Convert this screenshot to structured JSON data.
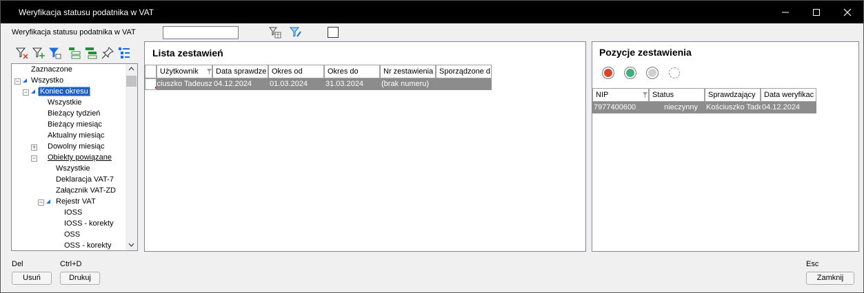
{
  "window": {
    "title": "Weryfikacja statusu podatnika w VAT"
  },
  "header": {
    "label": "Weryfikacja statusu podatnika w VAT",
    "search_value": ""
  },
  "tree": {
    "items": [
      {
        "label": "Zaznaczone"
      },
      {
        "label": "Wszystko"
      },
      {
        "label": "Koniec okresu"
      },
      {
        "label": "Wszystkie"
      },
      {
        "label": "Bieżący tydzień"
      },
      {
        "label": "Bieżący miesiąc"
      },
      {
        "label": "Aktualny miesiąc"
      },
      {
        "label": "Dowolny miesiąc"
      },
      {
        "label": "Obiekty powiązane"
      },
      {
        "label": "Wszystkie"
      },
      {
        "label": "Deklaracja VAT-7"
      },
      {
        "label": "Załącznik VAT-ZD"
      },
      {
        "label": "Rejestr VAT"
      },
      {
        "label": "IOSS"
      },
      {
        "label": "IOSS - korekty"
      },
      {
        "label": "OSS"
      },
      {
        "label": "OSS - korekty"
      }
    ]
  },
  "list": {
    "title": "Lista zestawień",
    "columns": [
      "Użytkownik",
      "Data sprawdze",
      "Okres od",
      "Okres do",
      "Nr zestawienia",
      "Sporządzone d"
    ],
    "rows": [
      [
        "ciuszko Tadeusz",
        "04.12.2024",
        "01.03.2024",
        "31.03.2024",
        "(brak numeru)",
        ""
      ]
    ]
  },
  "positions": {
    "title": "Pozycje zestawienia",
    "columns": [
      "NIP",
      "Status",
      "Sprawdzający",
      "Data weryfikac"
    ],
    "rows": [
      [
        "7977400600",
        "nieczynny",
        "Kościuszko Tade",
        "04.12.2024"
      ]
    ]
  },
  "status_colors": {
    "red": "#d9432f",
    "green": "#3fae7a",
    "gray": "#c8c8c8"
  },
  "footer": {
    "delete_shortcut": "Del",
    "delete_label": "Usuń",
    "print_shortcut": "Ctrl+D",
    "print_label": "Drukuj",
    "close_shortcut": "Esc",
    "close_label": "Zamknij"
  }
}
